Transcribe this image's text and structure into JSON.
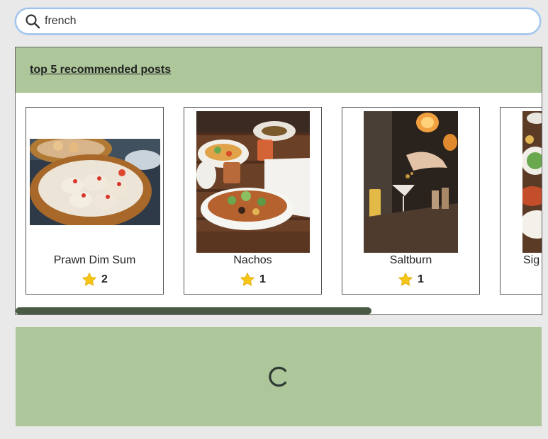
{
  "search": {
    "value": "french",
    "placeholder": ""
  },
  "recommended": {
    "title": "top 5 recommended posts",
    "posts": [
      {
        "name": "Prawn Dim Sum",
        "rating": "2",
        "image": "dim-sum-photo"
      },
      {
        "name": "Nachos",
        "rating": "1",
        "image": "nachos-photo"
      },
      {
        "name": "Saltburn",
        "rating": "1",
        "image": "cocktail-photo"
      },
      {
        "name": "Sig",
        "rating": "",
        "image": "food-table-photo"
      }
    ],
    "scroll_position": 0.0
  },
  "colors": {
    "accent_green": "#adc79a",
    "scrollbar": "#4a5a45",
    "search_border": "#9fc2ea",
    "star": "#f5c518"
  },
  "loader": {
    "icon": "spinner-icon"
  }
}
